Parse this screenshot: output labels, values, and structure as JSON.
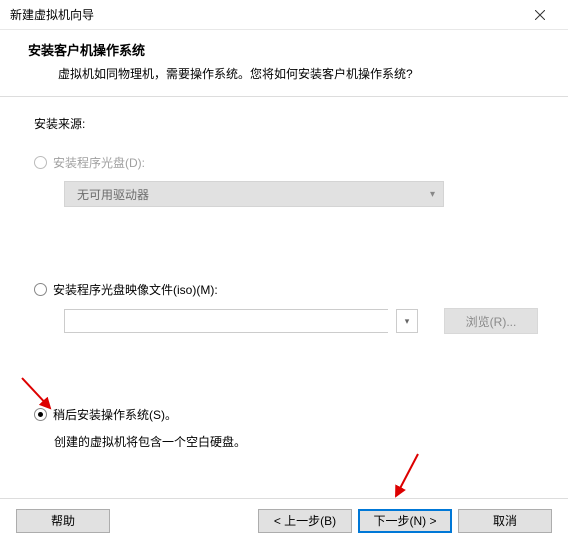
{
  "titlebar": {
    "title": "新建虚拟机向导"
  },
  "header": {
    "title": "安装客户机操作系统",
    "subtitle": "虚拟机如同物理机，需要操作系统。您将如何安装客户机操作系统?"
  },
  "body": {
    "source_label": "安装来源:",
    "opt_disc": {
      "label": "安装程序光盘(D):",
      "dropdown": "无可用驱动器"
    },
    "opt_iso": {
      "label": "安装程序光盘映像文件(iso)(M):",
      "browse": "浏览(R)..."
    },
    "opt_later": {
      "label": "稍后安装操作系统(S)。",
      "desc": "创建的虚拟机将包含一个空白硬盘。"
    }
  },
  "footer": {
    "help": "帮助",
    "back": "< 上一步(B)",
    "next": "下一步(N) >",
    "cancel": "取消"
  }
}
